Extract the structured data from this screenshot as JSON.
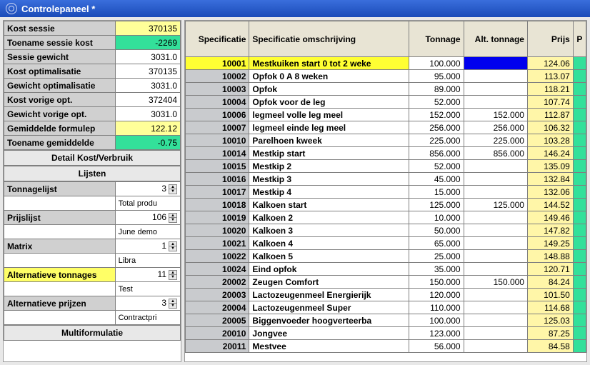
{
  "window_title": "Controlepaneel *",
  "summary": [
    {
      "label": "Kost sessie",
      "value": "370135",
      "vclass": "bg-yellow"
    },
    {
      "label": "Toename sessie kost",
      "value": "-2269",
      "vclass": "bg-green"
    },
    {
      "label": "Sessie gewicht",
      "value": "3031.0",
      "vclass": "bg-white"
    },
    {
      "label": "Kost optimalisatie",
      "value": "370135",
      "vclass": "bg-white"
    },
    {
      "label": "Gewicht optimalisatie",
      "value": "3031.0",
      "vclass": "bg-white"
    },
    {
      "label": "Kost vorige opt.",
      "value": "372404",
      "vclass": "bg-white"
    },
    {
      "label": "Gewicht vorige opt.",
      "value": "3031.0",
      "vclass": "bg-white"
    },
    {
      "label": "Gemiddelde formulep",
      "value": "122.12",
      "vclass": "bg-yellow"
    },
    {
      "label": "Toename gemiddelde",
      "value": "-0.75",
      "vclass": "bg-green"
    }
  ],
  "buttons": {
    "detail": "Detail Kost/Verbruik",
    "lijsten": "Lijsten",
    "multi": "Multiformulatie"
  },
  "props": [
    {
      "label": "Tonnagelijst",
      "value": "3",
      "sub": "Total produ",
      "lclass": ""
    },
    {
      "label": "Prijslijst",
      "value": "106",
      "sub": "June demo",
      "lclass": ""
    },
    {
      "label": "Matrix",
      "value": "1",
      "sub": "Libra",
      "lclass": ""
    },
    {
      "label": "Alternatieve tonnages",
      "value": "11",
      "sub": "Test",
      "lclass": "bg-yellowlabel"
    },
    {
      "label": "Alternatieve prijzen",
      "value": "3",
      "sub": "Contractpri",
      "lclass": ""
    }
  ],
  "columns": {
    "spec": "Specificatie",
    "desc": "Specificatie omschrijving",
    "ton": "Tonnage",
    "alt": "Alt. tonnage",
    "prijs": "Prijs",
    "p": "P"
  },
  "rows": [
    {
      "spec": "10001",
      "desc": "Mestkuiken start 0 tot 2 weke",
      "ton": "100.000",
      "alt": "",
      "prijs": "124.06",
      "sel": true
    },
    {
      "spec": "10002",
      "desc": "Opfok 0 A 8 weken",
      "ton": "95.000",
      "alt": "",
      "prijs": "113.07"
    },
    {
      "spec": "10003",
      "desc": "Opfok",
      "ton": "89.000",
      "alt": "",
      "prijs": "118.21"
    },
    {
      "spec": "10004",
      "desc": "Opfok voor de leg",
      "ton": "52.000",
      "alt": "",
      "prijs": "107.74"
    },
    {
      "spec": "10006",
      "desc": "legmeel volle leg meel",
      "ton": "152.000",
      "alt": "152.000",
      "prijs": "112.87"
    },
    {
      "spec": "10007",
      "desc": "legmeel einde leg meel",
      "ton": "256.000",
      "alt": "256.000",
      "prijs": "106.32"
    },
    {
      "spec": "10010",
      "desc": "Parelhoen kweek",
      "ton": "225.000",
      "alt": "225.000",
      "prijs": "103.28"
    },
    {
      "spec": "10014",
      "desc": "Mestkip start",
      "ton": "856.000",
      "alt": "856.000",
      "prijs": "146.24"
    },
    {
      "spec": "10015",
      "desc": "Mestkip 2",
      "ton": "52.000",
      "alt": "",
      "prijs": "135.09"
    },
    {
      "spec": "10016",
      "desc": "Mestkip 3",
      "ton": "45.000",
      "alt": "",
      "prijs": "132.84"
    },
    {
      "spec": "10017",
      "desc": "Mestkip 4",
      "ton": "15.000",
      "alt": "",
      "prijs": "132.06"
    },
    {
      "spec": "10018",
      "desc": "Kalkoen start",
      "ton": "125.000",
      "alt": "125.000",
      "prijs": "144.52"
    },
    {
      "spec": "10019",
      "desc": "Kalkoen 2",
      "ton": "10.000",
      "alt": "",
      "prijs": "149.46"
    },
    {
      "spec": "10020",
      "desc": "Kalkoen 3",
      "ton": "50.000",
      "alt": "",
      "prijs": "147.82"
    },
    {
      "spec": "10021",
      "desc": "Kalkoen 4",
      "ton": "65.000",
      "alt": "",
      "prijs": "149.25"
    },
    {
      "spec": "10022",
      "desc": "Kalkoen 5",
      "ton": "25.000",
      "alt": "",
      "prijs": "148.88"
    },
    {
      "spec": "10024",
      "desc": "Eind opfok",
      "ton": "35.000",
      "alt": "",
      "prijs": "120.71"
    },
    {
      "spec": "20002",
      "desc": "Zeugen Comfort",
      "ton": "150.000",
      "alt": "150.000",
      "prijs": "84.24"
    },
    {
      "spec": "20003",
      "desc": "Lactozeugenmeel Energierijk",
      "ton": "120.000",
      "alt": "",
      "prijs": "101.50"
    },
    {
      "spec": "20004",
      "desc": "Lactozeugenmeel Super",
      "ton": "110.000",
      "alt": "",
      "prijs": "114.68"
    },
    {
      "spec": "20005",
      "desc": "Biggenvoeder hoogverteerba",
      "ton": "100.000",
      "alt": "",
      "prijs": "125.03"
    },
    {
      "spec": "20010",
      "desc": "Jongvee",
      "ton": "123.000",
      "alt": "",
      "prijs": "87.25"
    },
    {
      "spec": "20011",
      "desc": "Mestvee",
      "ton": "56.000",
      "alt": "",
      "prijs": "84.58"
    }
  ]
}
